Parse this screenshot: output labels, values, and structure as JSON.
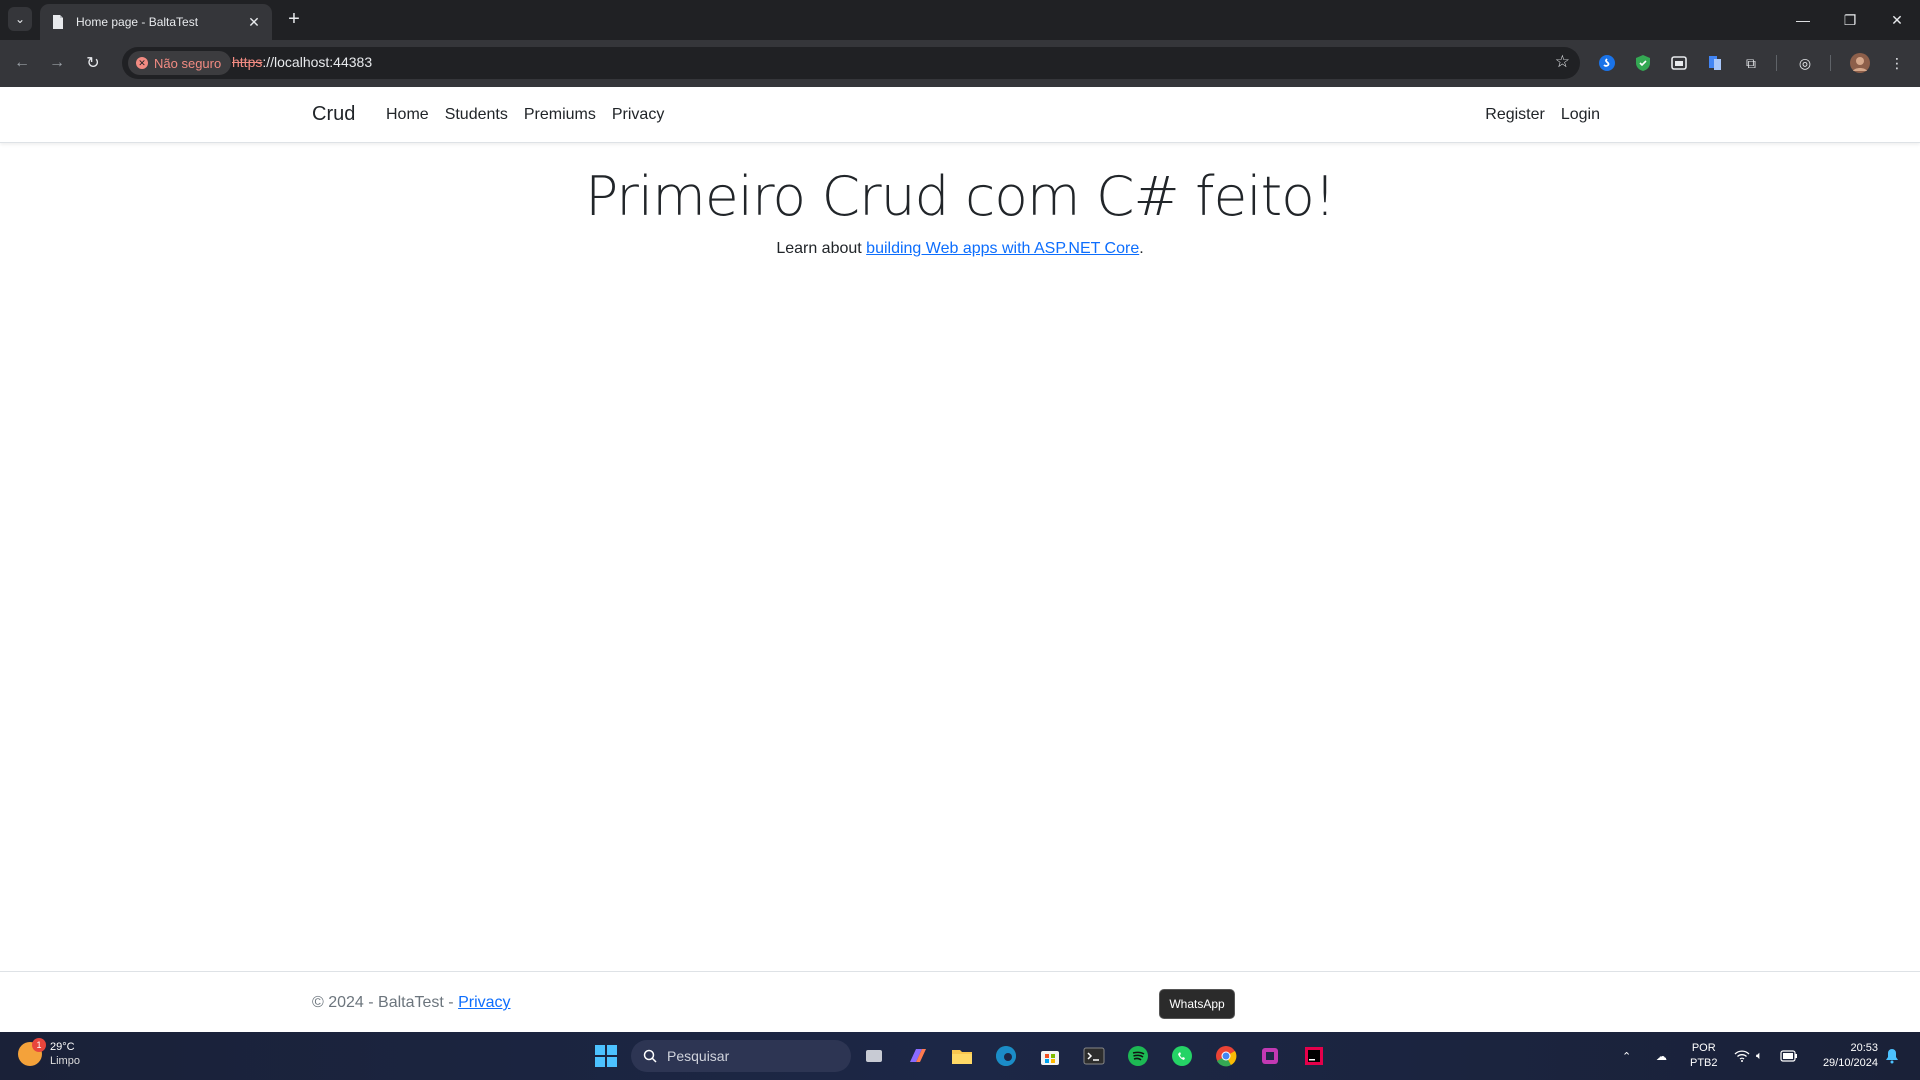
{
  "browser": {
    "tab_title": "Home page - BaltaTest",
    "security_chip": "Não seguro",
    "url_scheme": "https",
    "url_rest": "://localhost:44383"
  },
  "site": {
    "brand": "Crud",
    "nav": [
      "Home",
      "Students",
      "Premiums",
      "Privacy"
    ],
    "right_nav": [
      "Register",
      "Login"
    ],
    "heading": "Primeiro Crud com C# feito!",
    "intro_prefix": "Learn about ",
    "intro_link": "building Web apps with ASP.NET Core",
    "intro_suffix": ".",
    "footer_text": "© 2024 - BaltaTest - ",
    "footer_link": "Privacy"
  },
  "tooltip": "WhatsApp",
  "taskbar": {
    "weather_temp": "29°C",
    "weather_desc": "Limpo",
    "weather_badge": "1",
    "search_placeholder": "Pesquisar",
    "lang_top": "POR",
    "lang_bottom": "PTB2",
    "time": "20:53",
    "date": "29/10/2024"
  },
  "colors": {
    "link": "#0d6efd",
    "chrome_dark": "#202124",
    "chrome_toolbar": "#35363a",
    "warning": "#f28b82"
  }
}
